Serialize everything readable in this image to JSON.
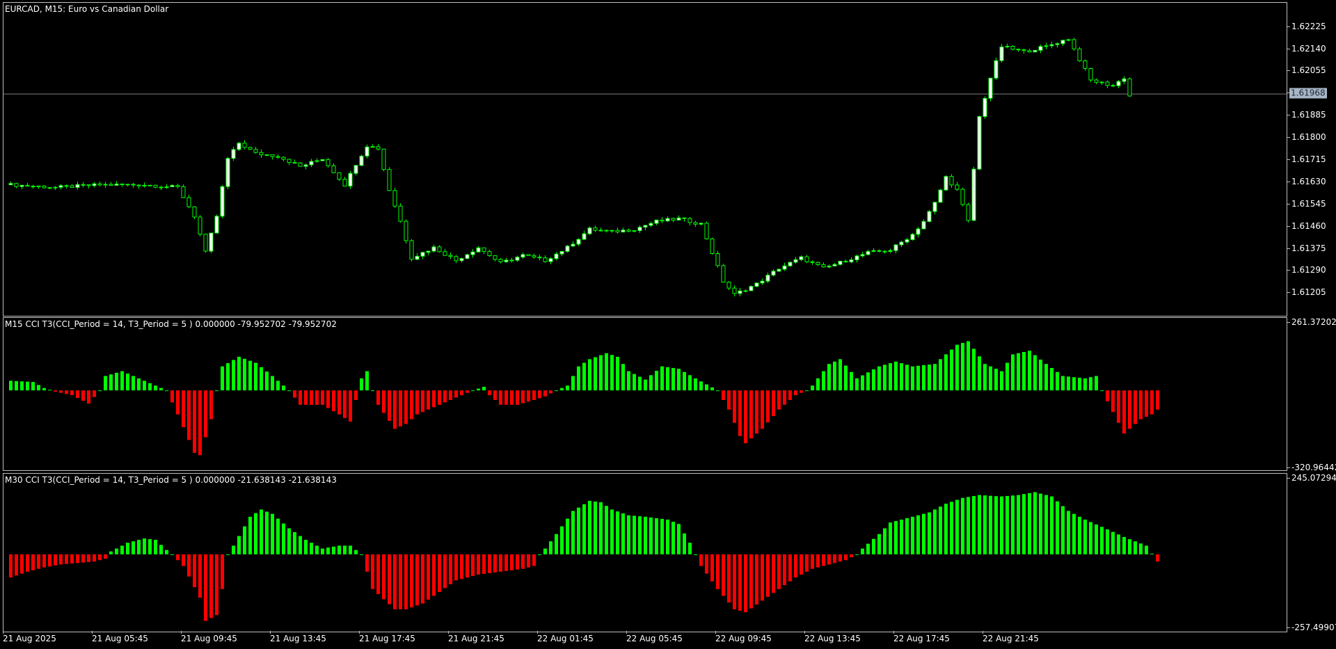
{
  "chart_data": [
    {
      "type": "candlestick",
      "title": "EURCAD, M15:  Euro vs Canadian Dollar",
      "symbol": "EURCAD",
      "timeframe": "M15",
      "colors": {
        "bull": "#ffffff",
        "bear": "#000000",
        "wick": "#00ff00",
        "outline": "#00ff00",
        "bid_line": "#808080"
      },
      "bid_price": "1.61968",
      "bid_value": 1.61968,
      "ylim": [
        1.6115,
        1.6228
      ],
      "y_ticks": [
        "1.62225",
        "1.62140",
        "1.62055",
        "1.61970",
        "1.61885",
        "1.61800",
        "1.61715",
        "1.61630",
        "1.61545",
        "1.61460",
        "1.61375",
        "1.61290",
        "1.61205"
      ],
      "x_ticks": [
        "21 Aug 2025",
        "21 Aug 05:45",
        "21 Aug 09:45",
        "21 Aug 13:45",
        "21 Aug 17:45",
        "21 Aug 21:45",
        "22 Aug 01:45",
        "22 Aug 05:45",
        "22 Aug 09:45",
        "22 Aug 13:45",
        "22 Aug 17:45",
        "22 Aug 21:45"
      ],
      "bars_per_tick": 16,
      "close_path": [
        [
          0,
          1.6162
        ],
        [
          8,
          1.6161
        ],
        [
          16,
          1.6162
        ],
        [
          24,
          1.6162
        ],
        [
          30,
          1.6161
        ],
        [
          33,
          1.615
        ],
        [
          35,
          1.6136
        ],
        [
          37,
          1.615
        ],
        [
          39,
          1.6172
        ],
        [
          41,
          1.6178
        ],
        [
          44,
          1.6174
        ],
        [
          48,
          1.6173
        ],
        [
          52,
          1.6169
        ],
        [
          56,
          1.6172
        ],
        [
          60,
          1.6162
        ],
        [
          62,
          1.617
        ],
        [
          64,
          1.6177
        ],
        [
          66,
          1.6176
        ],
        [
          68,
          1.616
        ],
        [
          70,
          1.6148
        ],
        [
          72,
          1.6134
        ],
        [
          76,
          1.6138
        ],
        [
          80,
          1.6133
        ],
        [
          84,
          1.6138
        ],
        [
          88,
          1.6132
        ],
        [
          92,
          1.6135
        ],
        [
          96,
          1.6133
        ],
        [
          100,
          1.6138
        ],
        [
          104,
          1.6145
        ],
        [
          108,
          1.6144
        ],
        [
          112,
          1.6145
        ],
        [
          116,
          1.6148
        ],
        [
          120,
          1.6149
        ],
        [
          124,
          1.6147
        ],
        [
          126,
          1.6136
        ],
        [
          128,
          1.6125
        ],
        [
          130,
          1.612
        ],
        [
          134,
          1.6124
        ],
        [
          138,
          1.613
        ],
        [
          142,
          1.6134
        ],
        [
          146,
          1.613
        ],
        [
          150,
          1.6133
        ],
        [
          154,
          1.6136
        ],
        [
          158,
          1.6137
        ],
        [
          162,
          1.6143
        ],
        [
          164,
          1.6148
        ],
        [
          166,
          1.6155
        ],
        [
          168,
          1.6165
        ],
        [
          170,
          1.616
        ],
        [
          172,
          1.6148
        ],
        [
          174,
          1.6188
        ],
        [
          176,
          1.6203
        ],
        [
          178,
          1.6215
        ],
        [
          182,
          1.6213
        ],
        [
          186,
          1.6215
        ],
        [
          190,
          1.6218
        ],
        [
          192,
          1.621
        ],
        [
          194,
          1.6202
        ],
        [
          198,
          1.62
        ],
        [
          200,
          1.6203
        ],
        [
          201,
          1.6196
        ]
      ],
      "volatility": 0.00012
    },
    {
      "type": "bar",
      "title": "M15 CCI T3(CCI_Period = 14, T3_Period = 5 ) 0.000000 -79.952702 -79.952702",
      "y_max_label": "261.372024",
      "y_min_label": "-320.96442",
      "ylim": [
        -320.96442,
        261.372024
      ],
      "colors": {
        "positive": "#00ff00",
        "negative": "#ff0000"
      },
      "values_path": [
        [
          0,
          40
        ],
        [
          4,
          35
        ],
        [
          6,
          10
        ],
        [
          8,
          -5
        ],
        [
          11,
          -20
        ],
        [
          14,
          -55
        ],
        [
          16,
          0
        ],
        [
          17,
          60
        ],
        [
          20,
          80
        ],
        [
          23,
          50
        ],
        [
          26,
          20
        ],
        [
          28,
          0
        ],
        [
          30,
          -100
        ],
        [
          33,
          -260
        ],
        [
          34,
          -270
        ],
        [
          36,
          -120
        ],
        [
          37,
          0
        ],
        [
          38,
          100
        ],
        [
          41,
          140
        ],
        [
          44,
          115
        ],
        [
          47,
          60
        ],
        [
          50,
          0
        ],
        [
          52,
          -60
        ],
        [
          56,
          -60
        ],
        [
          59,
          -100
        ],
        [
          61,
          -130
        ],
        [
          63,
          50
        ],
        [
          64,
          80
        ],
        [
          65,
          0
        ],
        [
          66,
          -60
        ],
        [
          69,
          -160
        ],
        [
          71,
          -140
        ],
        [
          73,
          -100
        ],
        [
          76,
          -70
        ],
        [
          79,
          -40
        ],
        [
          81,
          -20
        ],
        [
          83,
          0
        ],
        [
          85,
          15
        ],
        [
          86,
          -20
        ],
        [
          88,
          -60
        ],
        [
          91,
          -60
        ],
        [
          94,
          -40
        ],
        [
          96,
          -25
        ],
        [
          98,
          0
        ],
        [
          100,
          20
        ],
        [
          102,
          100
        ],
        [
          104,
          130
        ],
        [
          107,
          155
        ],
        [
          109,
          140
        ],
        [
          111,
          80
        ],
        [
          114,
          45
        ],
        [
          117,
          100
        ],
        [
          120,
          90
        ],
        [
          123,
          50
        ],
        [
          127,
          0
        ],
        [
          129,
          -80
        ],
        [
          131,
          -190
        ],
        [
          132,
          -220
        ],
        [
          135,
          -160
        ],
        [
          138,
          -80
        ],
        [
          141,
          -20
        ],
        [
          143,
          0
        ],
        [
          144,
          20
        ],
        [
          147,
          110
        ],
        [
          149,
          130
        ],
        [
          152,
          50
        ],
        [
          156,
          100
        ],
        [
          159,
          120
        ],
        [
          162,
          100
        ],
        [
          166,
          110
        ],
        [
          170,
          190
        ],
        [
          172,
          205
        ],
        [
          175,
          110
        ],
        [
          178,
          80
        ],
        [
          180,
          150
        ],
        [
          183,
          165
        ],
        [
          186,
          110
        ],
        [
          189,
          60
        ],
        [
          193,
          50
        ],
        [
          195,
          60
        ],
        [
          196,
          0
        ],
        [
          198,
          -90
        ],
        [
          200,
          -180
        ],
        [
          203,
          -120
        ],
        [
          205,
          -100
        ],
        [
          206,
          -80
        ]
      ]
    },
    {
      "type": "bar",
      "title": "M30 CCI T3(CCI_Period = 14, T3_Period = 5 ) 0.000000 -21.638143 -21.638143",
      "y_max_label": "245.072948",
      "y_min_label": "-257.49907",
      "ylim": [
        -257.49907,
        245.072948
      ],
      "colors": {
        "positive": "#00ff00",
        "negative": "#ff0000"
      },
      "values_path": [
        [
          0,
          -80
        ],
        [
          3,
          -60
        ],
        [
          6,
          -45
        ],
        [
          9,
          -35
        ],
        [
          12,
          -30
        ],
        [
          15,
          -25
        ],
        [
          17,
          -15
        ],
        [
          18,
          10
        ],
        [
          21,
          40
        ],
        [
          24,
          55
        ],
        [
          26,
          50
        ],
        [
          28,
          15
        ],
        [
          29,
          0
        ],
        [
          31,
          -40
        ],
        [
          34,
          -150
        ],
        [
          35,
          -230
        ],
        [
          37,
          -210
        ],
        [
          38,
          -120
        ],
        [
          39,
          0
        ],
        [
          40,
          30
        ],
        [
          43,
          130
        ],
        [
          45,
          155
        ],
        [
          47,
          140
        ],
        [
          50,
          90
        ],
        [
          53,
          50
        ],
        [
          56,
          20
        ],
        [
          59,
          30
        ],
        [
          61,
          30
        ],
        [
          63,
          0
        ],
        [
          65,
          -120
        ],
        [
          69,
          -190
        ],
        [
          71,
          -190
        ],
        [
          74,
          -170
        ],
        [
          77,
          -130
        ],
        [
          80,
          -90
        ],
        [
          84,
          -70
        ],
        [
          88,
          -60
        ],
        [
          92,
          -50
        ],
        [
          94,
          -40
        ],
        [
          95,
          0
        ],
        [
          96,
          20
        ],
        [
          98,
          70
        ],
        [
          101,
          150
        ],
        [
          104,
          185
        ],
        [
          106,
          180
        ],
        [
          108,
          155
        ],
        [
          111,
          135
        ],
        [
          114,
          130
        ],
        [
          118,
          120
        ],
        [
          120,
          105
        ],
        [
          122,
          40
        ],
        [
          123,
          0
        ],
        [
          124,
          -40
        ],
        [
          127,
          -120
        ],
        [
          130,
          -190
        ],
        [
          132,
          -200
        ],
        [
          135,
          -160
        ],
        [
          138,
          -120
        ],
        [
          141,
          -80
        ],
        [
          144,
          -50
        ],
        [
          147,
          -35
        ],
        [
          150,
          -20
        ],
        [
          152,
          0
        ],
        [
          153,
          20
        ],
        [
          156,
          70
        ],
        [
          158,
          110
        ],
        [
          162,
          130
        ],
        [
          165,
          145
        ],
        [
          168,
          175
        ],
        [
          171,
          195
        ],
        [
          174,
          205
        ],
        [
          178,
          200
        ],
        [
          181,
          205
        ],
        [
          184,
          215
        ],
        [
          187,
          200
        ],
        [
          190,
          150
        ],
        [
          193,
          120
        ],
        [
          196,
          95
        ],
        [
          200,
          60
        ],
        [
          204,
          30
        ],
        [
          206,
          -25
        ]
      ]
    }
  ]
}
